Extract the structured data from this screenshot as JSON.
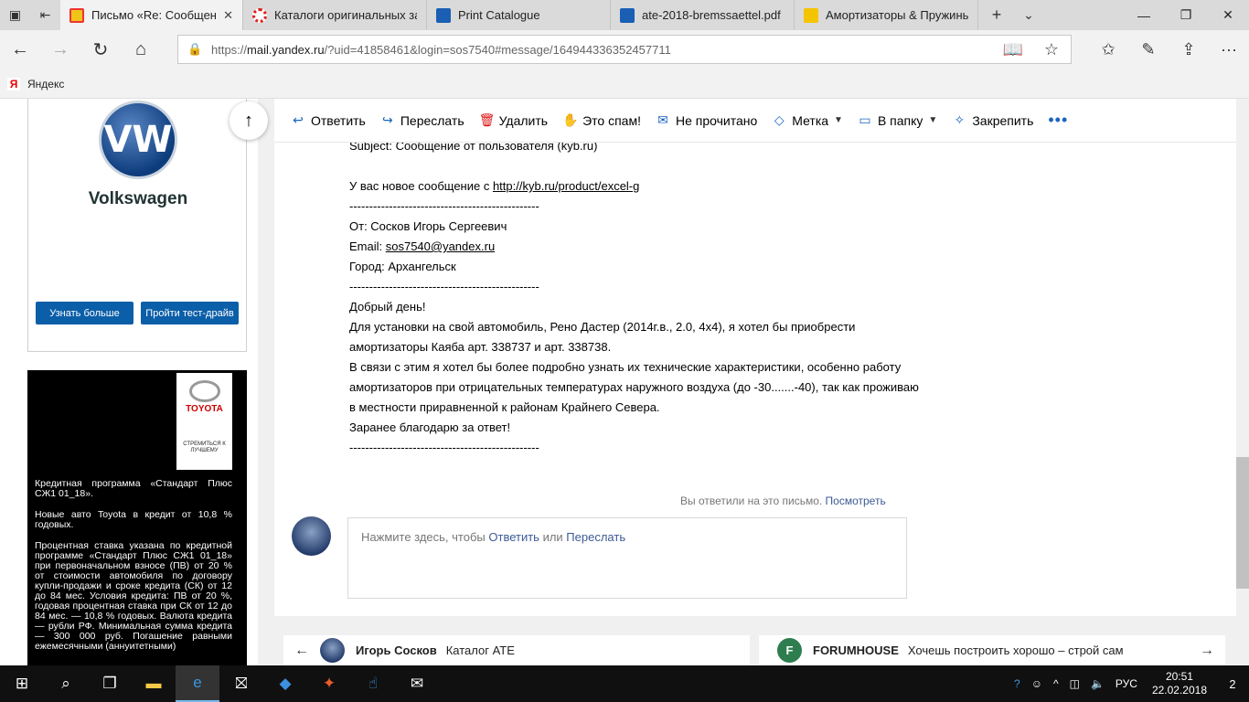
{
  "browser": {
    "tabs": [
      {
        "title": "Письмо «Re: Сообщени",
        "favicon_color": "#f0c419",
        "active": true
      },
      {
        "title": "Каталоги оригинальных за",
        "favicon_color": "#e02020",
        "active": false
      },
      {
        "title": "Print Catalogue",
        "favicon_color": "#1a5fb4",
        "active": false
      },
      {
        "title": "ate-2018-bremssaettel.pdf",
        "favicon_color": "#1a5fb4",
        "active": false
      },
      {
        "title": "Амортизаторы & Пружинь",
        "favicon_color": "#f5c400",
        "active": false
      }
    ],
    "url_prefix": "https://",
    "url_host": "mail.yandex.ru",
    "url_rest": "/?uid=41858461&login=sos7540#message/164944336352457711",
    "favorites": [
      {
        "label": "Яндекс"
      }
    ]
  },
  "toolbar": {
    "reply": "Ответить",
    "forward": "Переслать",
    "delete": "Удалить",
    "spam": "Это спам!",
    "unread": "Не прочитано",
    "label": "Метка",
    "folder": "В папку",
    "pin": "Закрепить",
    "more": "•••"
  },
  "message": {
    "lines": [
      {
        "text": "Subject: Сообщение от пользователя (kyb.ru)"
      },
      {
        "text": ""
      },
      {
        "text": "У вас новое сообщение с ",
        "link": "http://kyb.ru/product/excel-g"
      },
      {
        "text": "------------------------------------------------"
      },
      {
        "text": "От: Сосков Игорь Сергеевич"
      },
      {
        "text": "Email: ",
        "link": "sos7540@yandex.ru"
      },
      {
        "text": "Город: Архангельск"
      },
      {
        "text": "------------------------------------------------"
      },
      {
        "text": "Добрый день!"
      },
      {
        "text": "Для установки на свой автомобиль, Рено Дастер (2014г.в., 2.0, 4х4), я хотел бы приобрести"
      },
      {
        "text": "амортизаторы Каяба арт. 338737 и арт. 338738."
      },
      {
        "text": "В связи с этим я хотел бы более подробно узнать их технические характеристики, особенно работу"
      },
      {
        "text": "амортизаторов при отрицательных температурах наружного воздуха (до -30.......-40), так как проживаю"
      },
      {
        "text": "в местности приравненной к районам Крайнего Севера."
      },
      {
        "text": "Заранее благодарю за ответ!"
      },
      {
        "text": "------------------------------------------------"
      }
    ],
    "replied_text": "Вы ответили на это письмо.",
    "replied_link": "Посмотреть",
    "reply_prompt_start": "Нажмите здесь, чтобы ",
    "reply_prompt_reply": "Ответить",
    "reply_prompt_or": " или ",
    "reply_prompt_forward": "Переслать"
  },
  "nav": {
    "prev_sender": "Игорь Сосков",
    "prev_subject": "Каталог ATE",
    "next_sender": "FORUMHOUSE",
    "next_avatar_letter": "F",
    "next_subject": "Хочешь построить хорошо – строй сам"
  },
  "ads": {
    "vw_brand": "Volkswagen",
    "vw_logo_letters": "VW",
    "vw_btn_more": "Узнать больше",
    "vw_btn_test": "Пройти тест-драйв",
    "toyota_brand": "TOYOTA",
    "toyota_slogan": "СТРЕМИТЬСЯ К ЛУЧШЕМУ",
    "toyota_paragraphs": [
      "Кредитная программа «Стандарт Плюс СЖ1 01_18».",
      "Новые авто Toyota в кредит от 10,8 % годовых.",
      "Процентная ставка указана по кредитной программе «Стандарт Плюс СЖ1 01_18» при первоначальном взносе (ПВ) от 20 % от стоимости автомобиля по договору купли-продажи и сроке кредита (СК) от 12 до 84 мес. Условия кредита: ПВ от 20 %, годовая процентная ставка при СК от 12 до 84 мес. — 10,8 % годовых. Валюта кредита — рубли РФ. Минимальная сумма кредита — 300 000 руб. Погашение равными ежемесячными (аннуитетными)"
    ]
  },
  "taskbar": {
    "lang": "РУС",
    "time": "20:51",
    "date": "22.02.2018",
    "notifications": "2"
  }
}
